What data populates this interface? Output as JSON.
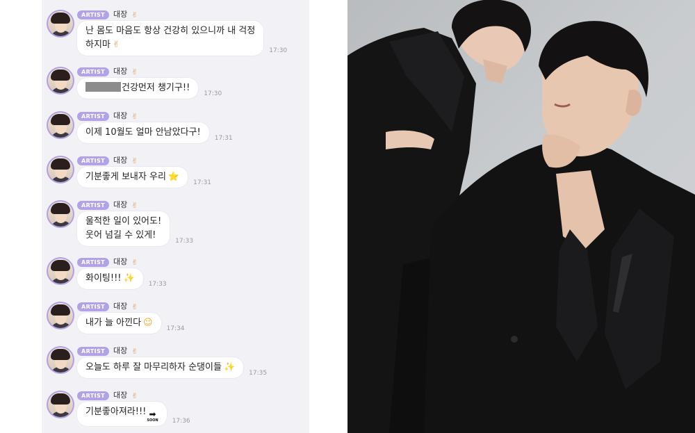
{
  "chat": {
    "badge_label": "ARTIST",
    "sender_name": "대장",
    "messages": [
      {
        "lines": [
          "난 몸도 마음도 항상 건강히 있으니까 내 걱정",
          "하지마"
        ],
        "emoji": "✌",
        "emoji_name": "victory-hand-emoji",
        "time": "17:30",
        "redacted_prefix": false
      },
      {
        "lines": [
          "건강먼저 챙기구!!"
        ],
        "emoji": "",
        "emoji_name": "",
        "time": "17:30",
        "redacted_prefix": true
      },
      {
        "lines": [
          "이제 10월도 얼마 안남았다구!"
        ],
        "emoji": "",
        "emoji_name": "",
        "time": "17:31",
        "redacted_prefix": false
      },
      {
        "lines": [
          "기분좋게 보내자 우리"
        ],
        "emoji": "⭐",
        "emoji_name": "star-emoji",
        "time": "17:31",
        "redacted_prefix": false
      },
      {
        "lines": [
          "울적한 일이 있어도!",
          "웃어 넘길 수 있게!"
        ],
        "emoji": "",
        "emoji_name": "",
        "time": "17:33",
        "redacted_prefix": false
      },
      {
        "lines": [
          "화이팅!!!"
        ],
        "emoji": "✨",
        "emoji_name": "sparkles-emoji",
        "time": "17:33",
        "redacted_prefix": false
      },
      {
        "lines": [
          "내가 늘 아낀다"
        ],
        "emoji": "☺",
        "emoji_name": "smiling-face-emoji",
        "time": "17:34",
        "redacted_prefix": false
      },
      {
        "lines": [
          "오늘도 하루 잘 마무리하자 순댕이들"
        ],
        "emoji": "✨",
        "emoji_name": "sparkles-emoji",
        "time": "17:35",
        "redacted_prefix": false
      },
      {
        "lines": [
          "기분좋아져라!!!"
        ],
        "emoji": "soon",
        "emoji_name": "soon-arrow-emoji",
        "time": "17:36",
        "redacted_prefix": false
      }
    ],
    "soon_label": "SOON"
  },
  "photo": {
    "icon": "two-men-black-suits-photo",
    "background_color": "#c4c7ca",
    "suit_color": "#0f0f10"
  },
  "colors": {
    "badge": "#b3a3e6",
    "chat_background": "#f2f1f6",
    "bubble": "#ffffff",
    "timestamp": "#9a9a9a"
  }
}
